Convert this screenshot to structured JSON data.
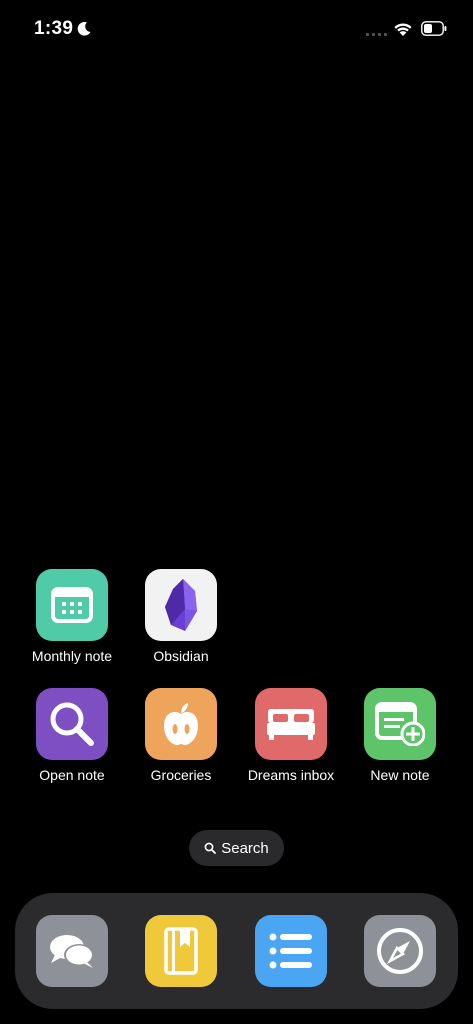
{
  "status_bar": {
    "time": "1:39",
    "moon_icon": "moon-icon",
    "wifi_icon": "wifi-icon",
    "battery_icon": "battery-icon"
  },
  "apps": [
    {
      "label": "Monthly note",
      "icon": "calendar-icon",
      "color": "#4fcba8"
    },
    {
      "label": "Obsidian",
      "icon": "obsidian-crystal-icon",
      "color": "#f2f2f2"
    },
    {
      "label": "Open note",
      "icon": "magnifier-icon",
      "color": "#7d4fc3"
    },
    {
      "label": "Groceries",
      "icon": "apple-icon",
      "color": "#eea45a"
    },
    {
      "label": "Dreams inbox",
      "icon": "bed-icon",
      "color": "#e06a6a"
    },
    {
      "label": "New note",
      "icon": "new-note-icon",
      "color": "#5ec46a"
    }
  ],
  "search": {
    "label": "Search",
    "icon": "search-icon"
  },
  "dock": [
    {
      "icon": "messages-bubbles-icon",
      "color": "#8e9197"
    },
    {
      "icon": "bookmark-book-icon",
      "color": "#f0c93a"
    },
    {
      "icon": "list-icon",
      "color": "#4aa6f2"
    },
    {
      "icon": "compass-icon",
      "color": "#8e9197"
    }
  ]
}
